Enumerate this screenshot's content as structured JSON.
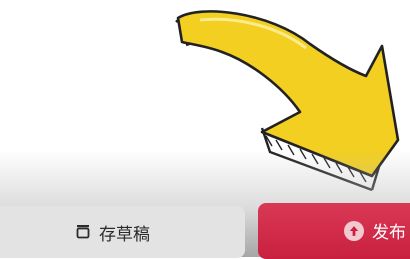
{
  "illustration": {
    "name": "yellow-arrow-graphic",
    "fill": "#f2cf21",
    "outline": "#222222"
  },
  "actions": {
    "save_draft_label": "存草稿",
    "publish_label": "发布",
    "publish_color": "#d12f4c"
  },
  "icons": {
    "draft": "draft-box-icon",
    "publish": "upload-arrow-icon"
  }
}
